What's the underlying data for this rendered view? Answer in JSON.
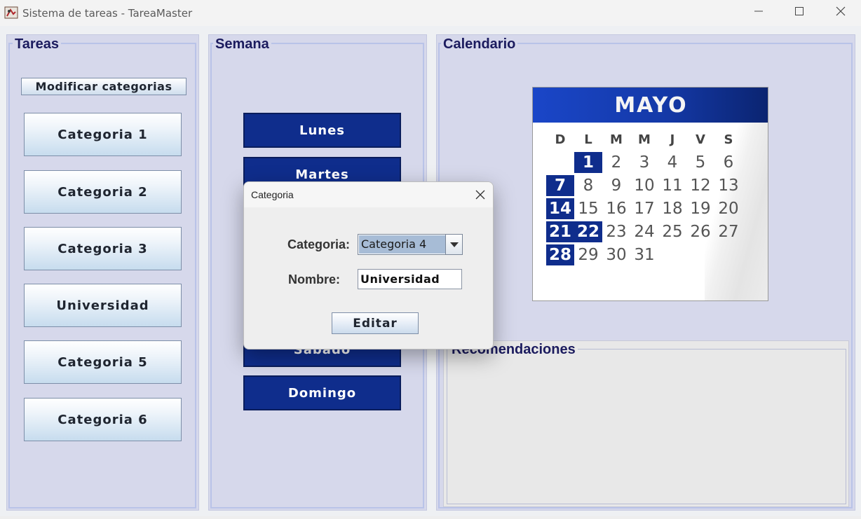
{
  "window": {
    "title": "Sistema de tareas - TareaMaster",
    "minimize_icon": "minimize-icon",
    "maximize_icon": "maximize-icon",
    "close_icon": "close-icon"
  },
  "tareas": {
    "title": "Tareas",
    "modify_label": "Modificar categorias",
    "categories": [
      "Categoria 1",
      "Categoria 2",
      "Categoria 3",
      "Universidad",
      "Categoria 5",
      "Categoria 6"
    ]
  },
  "semana": {
    "title": "Semana",
    "days": [
      "Lunes",
      "Martes",
      "Sabado",
      "Domingo"
    ]
  },
  "calendario": {
    "title": "Calendario",
    "month": "MAYO",
    "weekdays": [
      "D",
      "L",
      "M",
      "M",
      "J",
      "V",
      "S"
    ],
    "days": [
      "1",
      "2",
      "3",
      "4",
      "5",
      "6",
      "7",
      "8",
      "9",
      "10",
      "11",
      "12",
      "13",
      "14",
      "15",
      "16",
      "17",
      "18",
      "19",
      "20",
      "21",
      "22",
      "23",
      "24",
      "25",
      "26",
      "27",
      "28",
      "29",
      "30",
      "31"
    ],
    "highlighted": [
      "1",
      "7",
      "14",
      "21",
      "22",
      "28"
    ]
  },
  "recomendaciones": {
    "title": "Recomendaciones"
  },
  "dialog": {
    "title": "Categoria",
    "categoria_label": "Categoria:",
    "categoria_value": "Categoria 4",
    "nombre_label": "Nombre:",
    "nombre_value": "Universidad",
    "edit_label": "Editar"
  },
  "colors": {
    "panel_bg": "#d6d8eb",
    "day_button": "#0f2d8c",
    "title_text": "#1b1b5e"
  }
}
